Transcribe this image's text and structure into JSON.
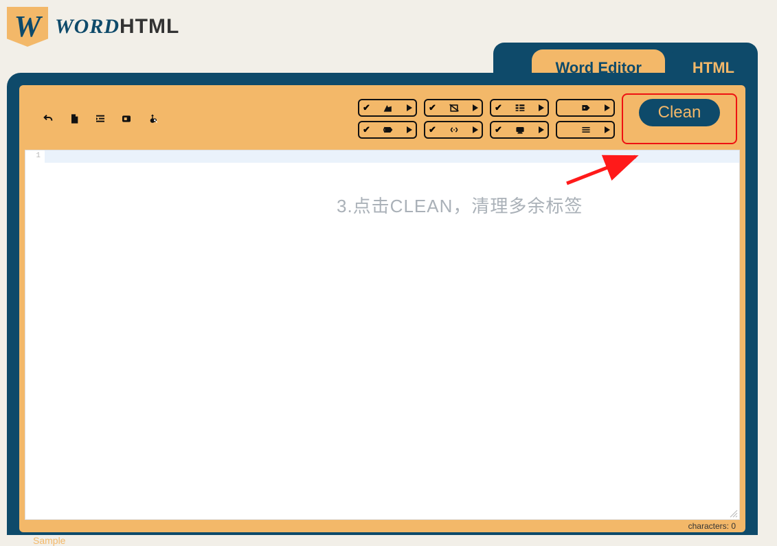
{
  "brand": {
    "word": "WORD",
    "html": "HTML",
    "logo_letter": "W"
  },
  "tabs": {
    "word": "Word Editor",
    "html": "HTML"
  },
  "toolbar_left": {
    "undo": "undo",
    "new": "new-file",
    "indent": "indent",
    "box": "container",
    "replace": "find-replace"
  },
  "clean_label": "Clean",
  "editor": {
    "line_number": "1",
    "content": ""
  },
  "status": {
    "label": "characters:",
    "count": "0"
  },
  "footer_link": "Sample",
  "annotation": "3.点击CLEAN，清理多余标签"
}
